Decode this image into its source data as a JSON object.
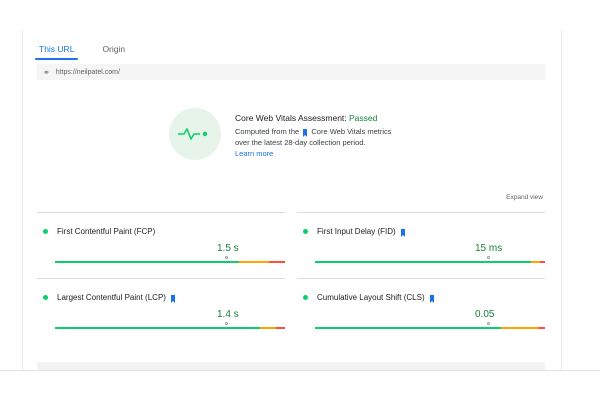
{
  "tabs": [
    {
      "label": "This URL",
      "active": true
    },
    {
      "label": "Origin",
      "active": false
    }
  ],
  "url": "https://neilpatel.com/",
  "assessment": {
    "title_prefix": "Core Web Vitals Assessment: ",
    "status": "Passed",
    "line1_before": "Computed from the",
    "line1_after": "Core Web Vitals metrics",
    "line2": "over the latest 28-day collection period.",
    "learn_more": "Learn more"
  },
  "expand_label": "Expand view",
  "metrics": [
    {
      "name": "First Contentful Paint (FCP)",
      "value": "1.5 s",
      "flag": false,
      "fast_pct": 0.8
    },
    {
      "name": "First Input Delay (FID)",
      "value": "15 ms",
      "flag": true,
      "fast_pct": 0.76
    },
    {
      "name": "Largest Contentful Paint (LCP)",
      "value": "1.4 s",
      "flag": true,
      "fast_pct": 0.8
    },
    {
      "name": "Cumulative Layout Shift (CLS)",
      "value": "0.05",
      "flag": true,
      "fast_pct": 0.76
    }
  ],
  "colors": {
    "good": "#0cce6b",
    "needs_improvement": "#ffa400",
    "poor": "#ff4e42",
    "accent": "#1a73e8"
  }
}
